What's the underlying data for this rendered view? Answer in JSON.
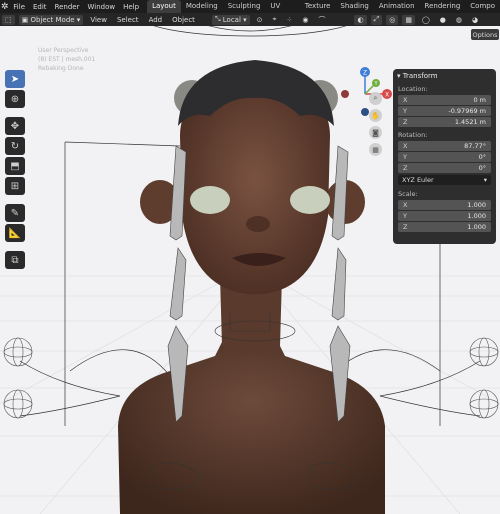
{
  "topbar": {
    "menu": [
      "File",
      "Edit",
      "Render",
      "Window",
      "Help"
    ],
    "workspaces": [
      "Layout",
      "Modeling",
      "Sculpting",
      "UV Editing",
      "Texture Paint",
      "Shading",
      "Animation",
      "Rendering",
      "Compo"
    ],
    "active_workspace": "Layout"
  },
  "header": {
    "mode": "Object Mode",
    "menus": [
      "View",
      "Select",
      "Add",
      "Object"
    ],
    "orientation": "Local"
  },
  "overlay": {
    "line1": "User Perspective",
    "line2": "(8) EST | mesh.001",
    "line3": "Rebaking Done"
  },
  "options_label": "Options",
  "gizmo": {
    "z": "Z",
    "x": "X",
    "y": "Y"
  },
  "npanel": {
    "title": "Transform",
    "location_label": "Location:",
    "location": [
      {
        "axis": "X",
        "value": "0 m"
      },
      {
        "axis": "Y",
        "value": "-0.97969 m"
      },
      {
        "axis": "Z",
        "value": "1.4521 m"
      }
    ],
    "rotation_label": "Rotation:",
    "rotation": [
      {
        "axis": "X",
        "value": "87.77°"
      },
      {
        "axis": "Y",
        "value": "0°"
      },
      {
        "axis": "Z",
        "value": "0°"
      }
    ],
    "rotation_mode": "XYZ Euler",
    "scale_label": "Scale:",
    "scale": [
      {
        "axis": "X",
        "value": "1.000"
      },
      {
        "axis": "Y",
        "value": "1.000"
      },
      {
        "axis": "Z",
        "value": "1.000"
      }
    ]
  }
}
